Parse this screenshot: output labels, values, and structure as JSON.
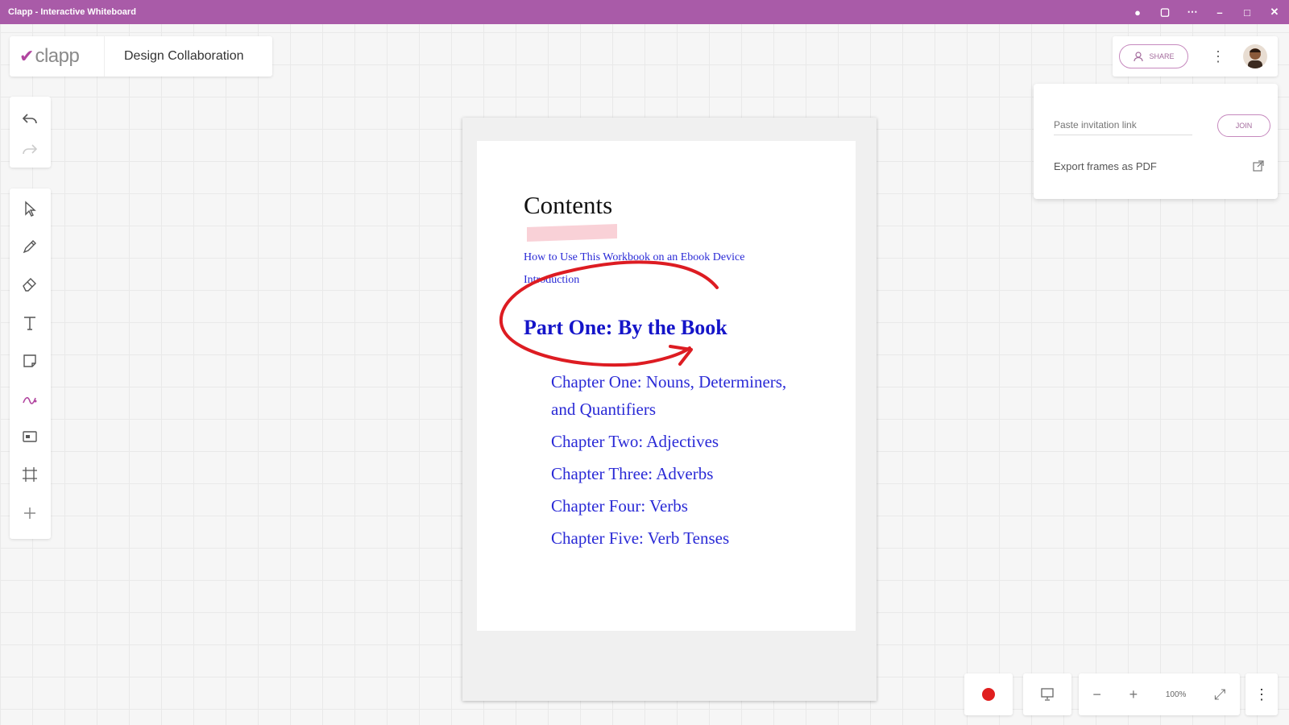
{
  "window": {
    "title": "Clapp - Interactive Whiteboard",
    "controls": [
      "●",
      "▢",
      "⋯",
      "–",
      "□",
      "✕"
    ]
  },
  "brand": {
    "logo_text": "clapp",
    "board_title": "Design Collaboration"
  },
  "header_right": {
    "share_label": "SHARE",
    "more_icon": "⋮"
  },
  "share_popup": {
    "invite_placeholder": "Paste invitation link",
    "join_label": "JOIN",
    "export_label": "Export frames as PDF"
  },
  "document": {
    "heading": "Contents",
    "intro_links": [
      "How to Use This Workbook on an Ebook Device",
      "Introduction"
    ],
    "part_title": "Part One: By the Book",
    "chapters": [
      "Chapter One: Nouns, Determiners,",
      "and Quantifiers",
      "Chapter Two: Adjectives",
      "Chapter Three: Adverbs",
      "Chapter Four: Verbs",
      "Chapter Five: Verb Tenses"
    ]
  },
  "bottom_controls": {
    "zoom_out": "−",
    "zoom_in": "+",
    "zoom_level": "100%",
    "fullscreen": "⤢",
    "menu": "⋮"
  },
  "colors": {
    "titlebar": "#a95ba8",
    "brand_accent": "#b1459f",
    "ink_annotation": "#dd1c22",
    "link_blue": "#2a2ad6",
    "record": "#e01f1f"
  }
}
